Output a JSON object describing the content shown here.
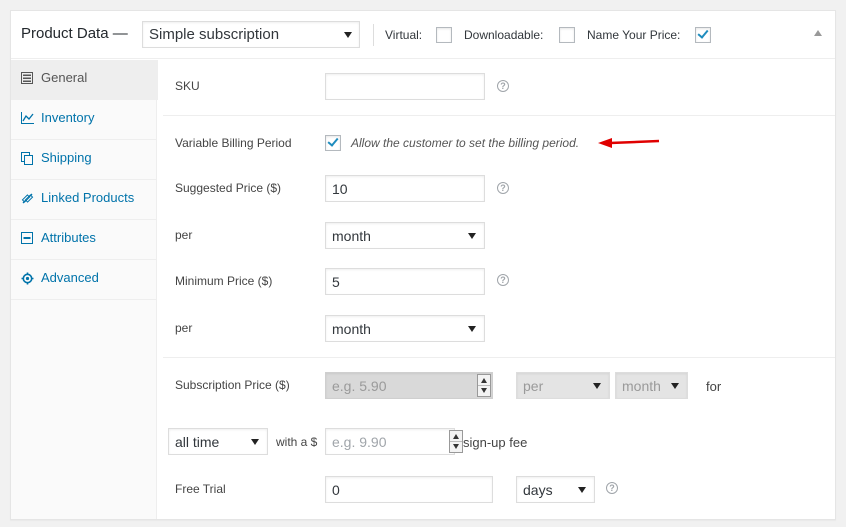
{
  "header": {
    "title": "Product Data —",
    "product_type": "Simple subscription",
    "virtual_label": "Virtual:",
    "downloadable_label": "Downloadable:",
    "nyp_label": "Name Your Price:"
  },
  "sidebar": {
    "items": [
      {
        "label": "General",
        "icon": "general-icon"
      },
      {
        "label": "Inventory",
        "icon": "inventory-icon"
      },
      {
        "label": "Shipping",
        "icon": "shipping-icon"
      },
      {
        "label": "Linked Products",
        "icon": "link-icon"
      },
      {
        "label": "Attributes",
        "icon": "attributes-icon"
      },
      {
        "label": "Advanced",
        "icon": "gear-icon"
      }
    ]
  },
  "form": {
    "sku_label": "SKU",
    "sku_value": "",
    "billing_label": "Variable Billing Period",
    "billing_desc": "Allow the customer to set the billing period.",
    "suggested_label": "Suggested Price ($)",
    "suggested_value": "10",
    "per_label": "per",
    "suggested_period": "month",
    "minimum_label": "Minimum Price ($)",
    "minimum_value": "5",
    "minimum_period": "month",
    "sub_price_label": "Subscription Price ($)",
    "sub_price_placeholder": "e.g. 5.90",
    "sub_interval": "per",
    "sub_period": "month",
    "for_label": "for",
    "length": "all time",
    "with_label": "with a $",
    "signup_placeholder": "e.g. 9.90",
    "signup_label": "sign-up fee",
    "trial_label": "Free Trial",
    "trial_value": "0",
    "trial_period": "days"
  },
  "colors": {
    "link": "#0073aa",
    "check": "#1e8cbe",
    "arrow": "#e00000"
  }
}
